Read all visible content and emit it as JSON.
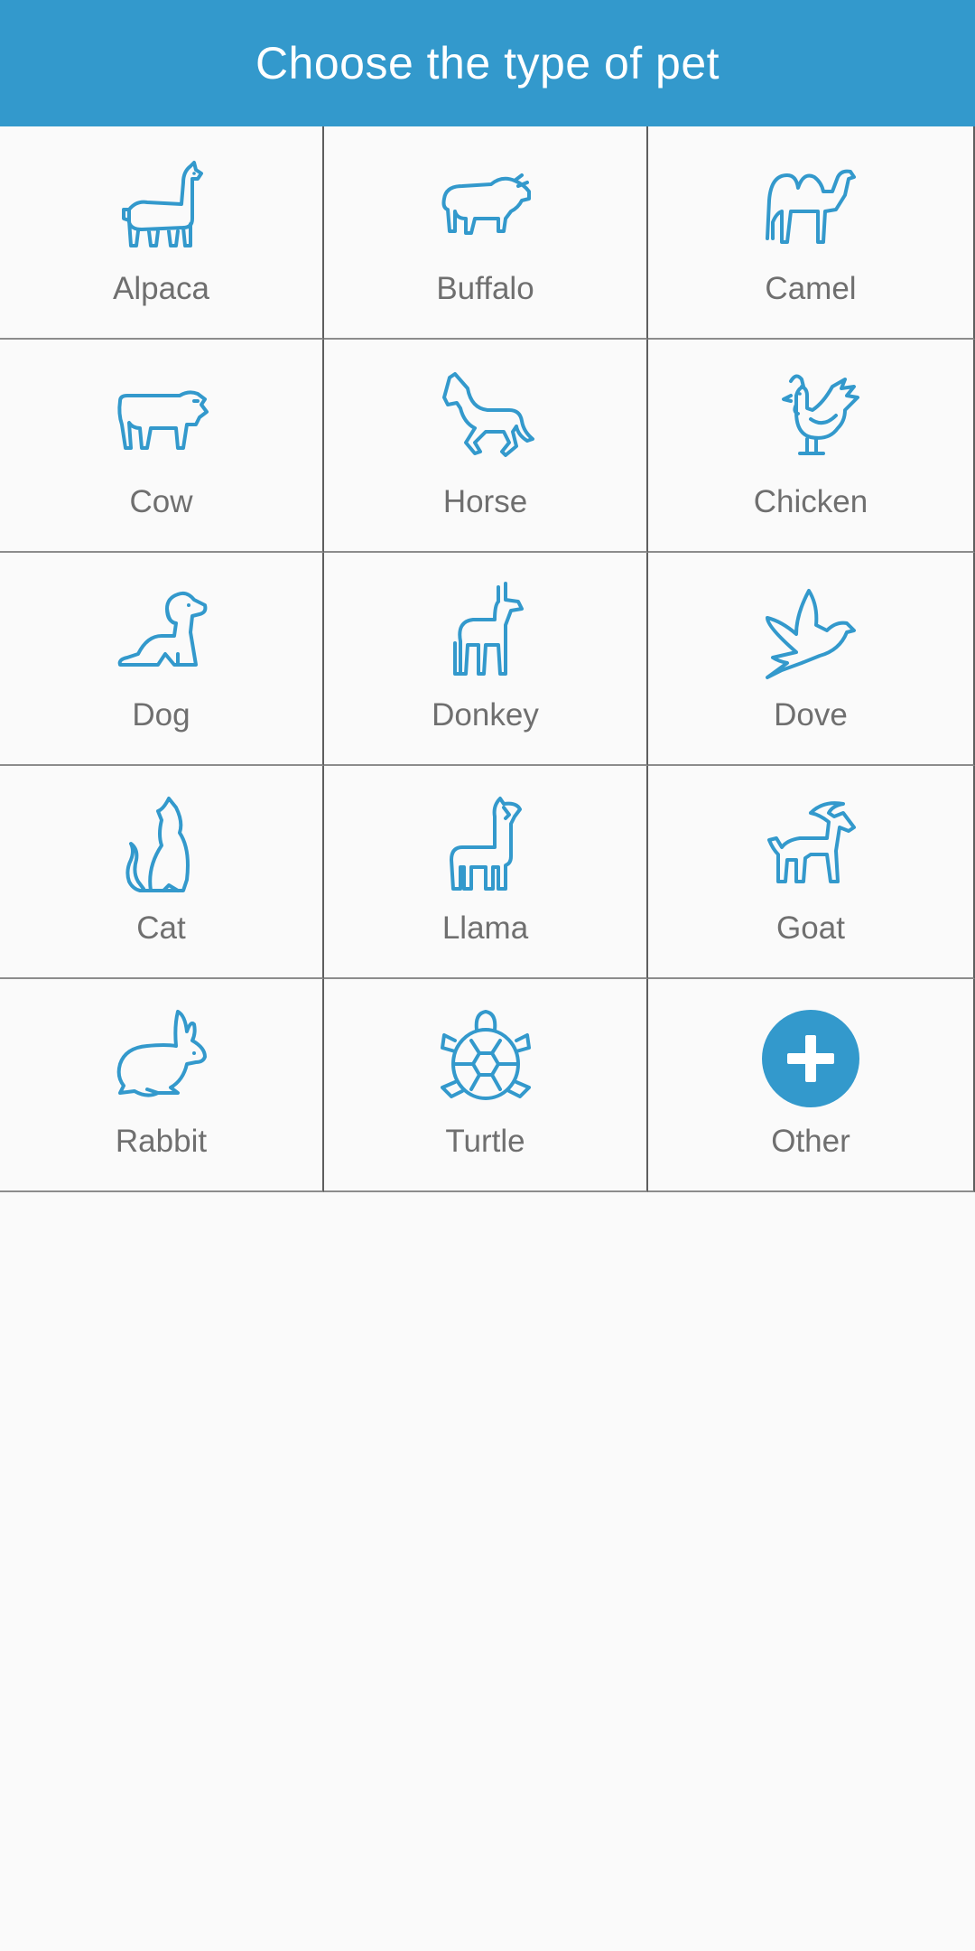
{
  "header": {
    "title": "Choose the type of pet"
  },
  "accent_color": "#3399cc",
  "pets": [
    {
      "label": "Alpaca",
      "icon": "alpaca-icon"
    },
    {
      "label": "Buffalo",
      "icon": "buffalo-icon"
    },
    {
      "label": "Camel",
      "icon": "camel-icon"
    },
    {
      "label": "Cow",
      "icon": "cow-icon"
    },
    {
      "label": "Horse",
      "icon": "horse-icon"
    },
    {
      "label": "Chicken",
      "icon": "chicken-icon"
    },
    {
      "label": "Dog",
      "icon": "dog-icon"
    },
    {
      "label": "Donkey",
      "icon": "donkey-icon"
    },
    {
      "label": "Dove",
      "icon": "dove-icon"
    },
    {
      "label": "Cat",
      "icon": "cat-icon"
    },
    {
      "label": "Llama",
      "icon": "llama-icon"
    },
    {
      "label": "Goat",
      "icon": "goat-icon"
    },
    {
      "label": "Rabbit",
      "icon": "rabbit-icon"
    },
    {
      "label": "Turtle",
      "icon": "turtle-icon"
    },
    {
      "label": "Other",
      "icon": "plus-circle-icon"
    }
  ]
}
